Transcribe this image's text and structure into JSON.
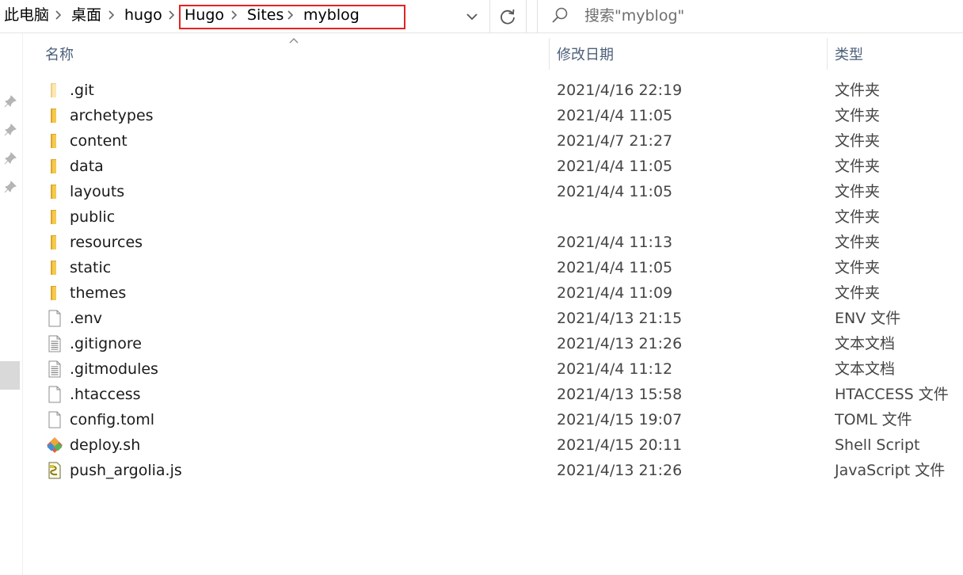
{
  "breadcrumb": {
    "items": [
      "此电脑",
      "桌面",
      "hugo",
      "Hugo",
      "Sites",
      "myblog"
    ]
  },
  "search": {
    "placeholder": "搜索\"myblog\""
  },
  "columns": {
    "name": "名称",
    "date": "修改日期",
    "type": "类型"
  },
  "files": [
    {
      "name": ".git",
      "date": "2021/4/16 22:19",
      "type": "文件夹",
      "icon": "folder-icon-light"
    },
    {
      "name": "archetypes",
      "date": "2021/4/4 11:05",
      "type": "文件夹",
      "icon": "folder-icon"
    },
    {
      "name": "content",
      "date": "2021/4/7 21:27",
      "type": "文件夹",
      "icon": "folder-icon"
    },
    {
      "name": "data",
      "date": "2021/4/4 11:05",
      "type": "文件夹",
      "icon": "folder-icon"
    },
    {
      "name": "layouts",
      "date": "2021/4/4 11:05",
      "type": "文件夹",
      "icon": "folder-icon"
    },
    {
      "name": "public",
      "date": "",
      "type": "文件夹",
      "icon": "folder-icon"
    },
    {
      "name": "resources",
      "date": "2021/4/4 11:13",
      "type": "文件夹",
      "icon": "folder-icon"
    },
    {
      "name": "static",
      "date": "2021/4/4 11:05",
      "type": "文件夹",
      "icon": "folder-icon"
    },
    {
      "name": "themes",
      "date": "2021/4/4 11:09",
      "type": "文件夹",
      "icon": "folder-icon"
    },
    {
      "name": ".env",
      "date": "2021/4/13 21:15",
      "type": "ENV 文件",
      "icon": "file-icon"
    },
    {
      "name": ".gitignore",
      "date": "2021/4/13 21:26",
      "type": "文本文档",
      "icon": "text-file-icon"
    },
    {
      "name": ".gitmodules",
      "date": "2021/4/4 11:12",
      "type": "文本文档",
      "icon": "text-file-icon"
    },
    {
      "name": ".htaccess",
      "date": "2021/4/13 15:58",
      "type": "HTACCESS 文件",
      "icon": "file-icon"
    },
    {
      "name": "config.toml",
      "date": "2021/4/15 19:07",
      "type": "TOML 文件",
      "icon": "file-icon"
    },
    {
      "name": "deploy.sh",
      "date": "2021/4/15 20:11",
      "type": "Shell Script",
      "icon": "git-script-icon"
    },
    {
      "name": "push_argolia.js",
      "date": "2021/4/13 21:26",
      "type": "JavaScript 文件",
      "icon": "javascript-file-icon"
    }
  ],
  "colors": {
    "highlight": "#e32222",
    "folder": "#f5c94b",
    "header_text": "#4c607a"
  }
}
